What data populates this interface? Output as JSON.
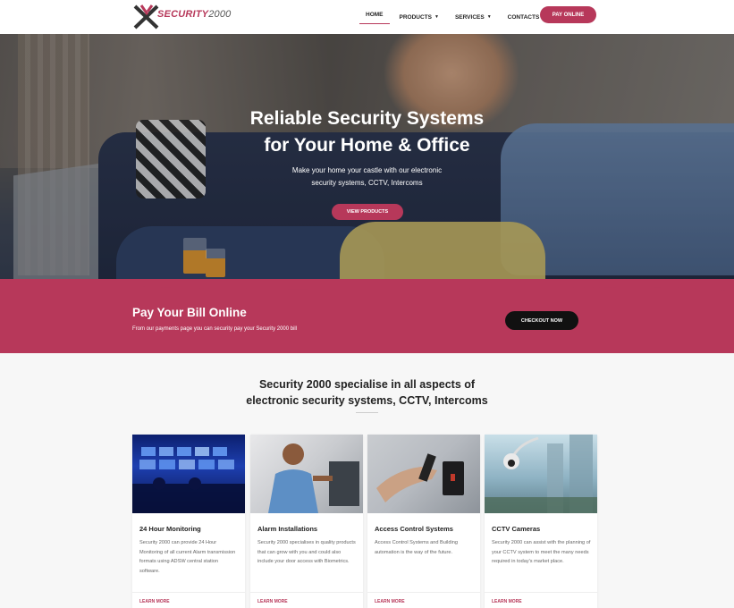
{
  "header": {
    "logo_primary": "SECURITY",
    "logo_secondary": "2000",
    "nav": [
      {
        "label": "HOME",
        "active": true,
        "has_dropdown": false
      },
      {
        "label": "PRODUCTS",
        "active": false,
        "has_dropdown": true
      },
      {
        "label": "SERVICES",
        "active": false,
        "has_dropdown": true
      },
      {
        "label": "CONTACTS",
        "active": false,
        "has_dropdown": false
      }
    ],
    "pay_online_label": "PAY ONLINE"
  },
  "hero": {
    "title_line1": "Reliable Security Systems",
    "title_line2": "for Your Home & Office",
    "subtitle_line1": "Make your home your castle with our electronic",
    "subtitle_line2": "security systems, CCTV, Intercoms",
    "button_label": "VIEW PRODUCTS"
  },
  "pay_band": {
    "title": "Pay Your Bill Online",
    "subtitle": "From our payments page you can security pay your Security 2000 bill",
    "button_label": "CHECKOUT NOW"
  },
  "specialise": {
    "title_line1": "Security 2000 specialise in all aspects of",
    "title_line2": "electronic security systems, CCTV, Intercoms"
  },
  "services": [
    {
      "title": "24 Hour Monitoring",
      "text": "Security 2000 can provide 24 Hour Monitoring of all current Alarm transmission formats using ADSW central station software.",
      "link": "LEARN MORE"
    },
    {
      "title": "Alarm Installations",
      "text": "Security 2000 specialises in quality products that can grow with you and could also include your door access with Biometrics.",
      "link": "LEARN MORE"
    },
    {
      "title": "Access Control Systems",
      "text": "Access Control Systems and Building automation is the way of the future.",
      "link": "LEARN MORE"
    },
    {
      "title": "CCTV Cameras",
      "text": "Security 2000 can assist with the planning of your CCTV system to meet the many needs required in today's market place.",
      "link": "LEARN MORE"
    }
  ],
  "colors": {
    "accent": "#b7385a",
    "dark_button": "#111111"
  },
  "icons": {
    "logo": "x-mark-logo-icon",
    "dropdown": "caret-down-icon"
  }
}
